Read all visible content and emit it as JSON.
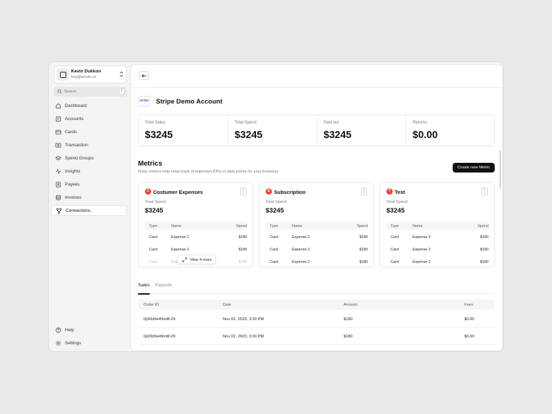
{
  "profile": {
    "name": "Kevin Dukkon",
    "email": "hey@kevdu.co"
  },
  "search": {
    "placeholder": "Search",
    "shortcut": "/"
  },
  "sidebar": {
    "items": [
      {
        "label": "Dashboard",
        "icon": "home-icon"
      },
      {
        "label": "Accounts",
        "icon": "accounts-icon"
      },
      {
        "label": "Cards",
        "icon": "card-icon"
      },
      {
        "label": "Transaction",
        "icon": "transaction-icon"
      },
      {
        "label": "Spend Groups",
        "icon": "layers-icon"
      },
      {
        "label": "Insights",
        "icon": "activity-icon"
      },
      {
        "label": "Payees",
        "icon": "user-icon"
      },
      {
        "label": "Invoices",
        "icon": "database-icon"
      },
      {
        "label": "Connections",
        "icon": "connections-icon",
        "active": true
      }
    ],
    "bottom": [
      {
        "label": "Help",
        "icon": "help-icon"
      },
      {
        "label": "Settings",
        "icon": "settings-icon"
      }
    ]
  },
  "account": {
    "logo_text": "stripe",
    "title": "Stripe Demo Account"
  },
  "stats": [
    {
      "label": "Total Sales",
      "value": "$3245"
    },
    {
      "label": "Total Spend",
      "value": "$3245"
    },
    {
      "label": "Paid out",
      "value": "$3245"
    },
    {
      "label": "Returns",
      "value": "$0.00"
    }
  ],
  "metrics": {
    "title": "Metrics",
    "subtitle": "Ruby metrics help keep track of important KPIs or data points for your business",
    "new_button": "Create new Metric",
    "table_headers": {
      "type": "Type",
      "name": "Name",
      "spend": "Spend"
    },
    "cards": [
      {
        "badge": "C",
        "badge_color": "#e8472b",
        "title": "Costumer Expenses",
        "spend_label": "Total Spend",
        "spend": "$3245",
        "menu": "⋮",
        "rows": [
          {
            "type": "Card",
            "name": "Expense 2",
            "spend": "$180"
          },
          {
            "type": "Card",
            "name": "Expense 2",
            "spend": "$180"
          },
          {
            "type": "Card",
            "name": "Exp",
            "spend": "$180"
          }
        ],
        "view_more": "View 4 more"
      },
      {
        "badge": "S",
        "badge_color": "#e8472b",
        "title": "Subscription",
        "spend_label": "Total Spend",
        "spend": "$3245",
        "menu": "⋮",
        "rows": [
          {
            "type": "Card",
            "name": "Expense 2",
            "spend": "$180"
          },
          {
            "type": "Card",
            "name": "Expense 2",
            "spend": "$180"
          },
          {
            "type": "Card",
            "name": "Expense 2",
            "spend": "$180"
          }
        ]
      },
      {
        "badge": "T",
        "badge_color": "#e8472b",
        "title": "Test",
        "spend_label": "Total Spend",
        "spend": "$3245",
        "menu": "⋮",
        "rows": [
          {
            "type": "Card",
            "name": "Expense 2",
            "spend": "$180"
          },
          {
            "type": "Card",
            "name": "Expense 2",
            "spend": "$180"
          },
          {
            "type": "Card",
            "name": "Expense 2",
            "spend": "$180"
          }
        ]
      }
    ]
  },
  "tabs": [
    {
      "label": "Sales",
      "active": true
    },
    {
      "label": "Payouts",
      "active": false
    }
  ],
  "sales_table": {
    "headers": {
      "order": "Order ID",
      "date": "Date",
      "amount": "Amount",
      "fees": "Fees"
    },
    "rows": [
      {
        "order": "0ji20d9e49irdif-29",
        "date": "Nov 02, 2023, 3:30 PM",
        "amount": "$180",
        "fees": "$0.00"
      },
      {
        "order": "0ji20d9e49irdif-29",
        "date": "Nov 02, 2023, 3:30 PM",
        "amount": "$180",
        "fees": "$0.00"
      }
    ]
  }
}
